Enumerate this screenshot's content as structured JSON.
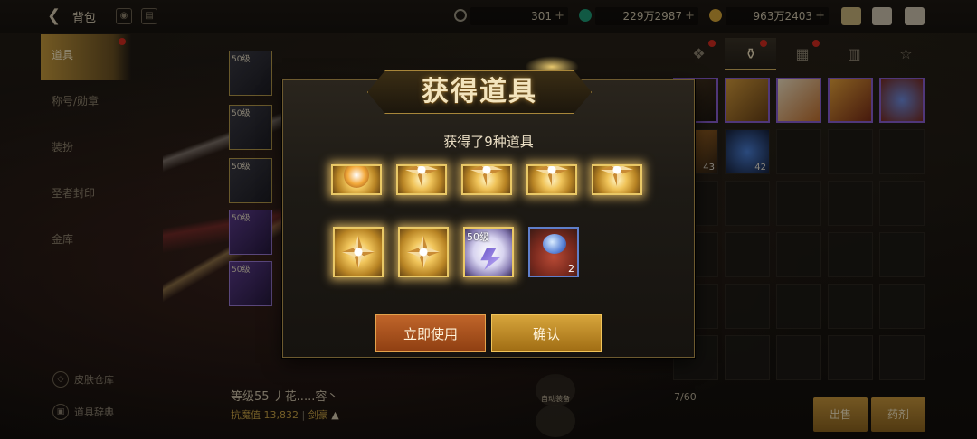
{
  "header": {
    "title": "背包",
    "back_icon": "back-arrow-icon",
    "icons": [
      "eye-icon",
      "book-icon"
    ]
  },
  "currencies": [
    {
      "icon": "fatigue-icon",
      "value": "301"
    },
    {
      "icon": "crystal-icon",
      "value": "229万2987"
    },
    {
      "icon": "gold-icon",
      "value": "963万2403"
    }
  ],
  "top_right_icons": [
    "cake-icon",
    "mail-icon",
    "chat-icon"
  ],
  "sidebar": {
    "items": [
      {
        "label": "道具",
        "active": true,
        "badge": true
      },
      {
        "label": "称号/勋章",
        "active": false,
        "badge": false
      },
      {
        "label": "装扮",
        "active": false,
        "badge": false
      },
      {
        "label": "圣者封印",
        "active": false,
        "badge": false
      },
      {
        "label": "金库",
        "active": false,
        "badge": false
      }
    ],
    "bottom": [
      {
        "label": "皮肤仓库"
      },
      {
        "label": "道具辞典"
      }
    ]
  },
  "equipment_slots": [
    {
      "level": "50级"
    },
    {
      "level": "50级"
    },
    {
      "level": "50级"
    },
    {
      "level": "50级"
    },
    {
      "level": "50级"
    }
  ],
  "character": {
    "name": "等级55 丿花.....容丶",
    "power_label": "抗魔值",
    "power_value": "13,832",
    "class": "剑豪"
  },
  "center_buttons": [
    "自动装备",
    ""
  ],
  "inventory": {
    "tabs": [
      {
        "icon": "paw-icon",
        "badge": true
      },
      {
        "icon": "potion-icon",
        "badge": true,
        "active": true
      },
      {
        "icon": "box-icon",
        "badge": true
      },
      {
        "icon": "scroll-icon",
        "badge": false
      },
      {
        "icon": "star-icon",
        "badge": false
      }
    ],
    "counts": [
      "43",
      "42"
    ],
    "capacity": "7/60",
    "buttons": {
      "sell": "出售",
      "expand": "药剂"
    }
  },
  "modal": {
    "title": "获得道具",
    "subtitle": "获得了9种道具",
    "rewards_row2": [
      {
        "type": "flower"
      },
      {
        "type": "flower"
      },
      {
        "type": "box",
        "level": "50级"
      },
      {
        "type": "bag",
        "count": "2"
      }
    ],
    "buttons": {
      "use": "立即使用",
      "confirm": "确认"
    }
  }
}
